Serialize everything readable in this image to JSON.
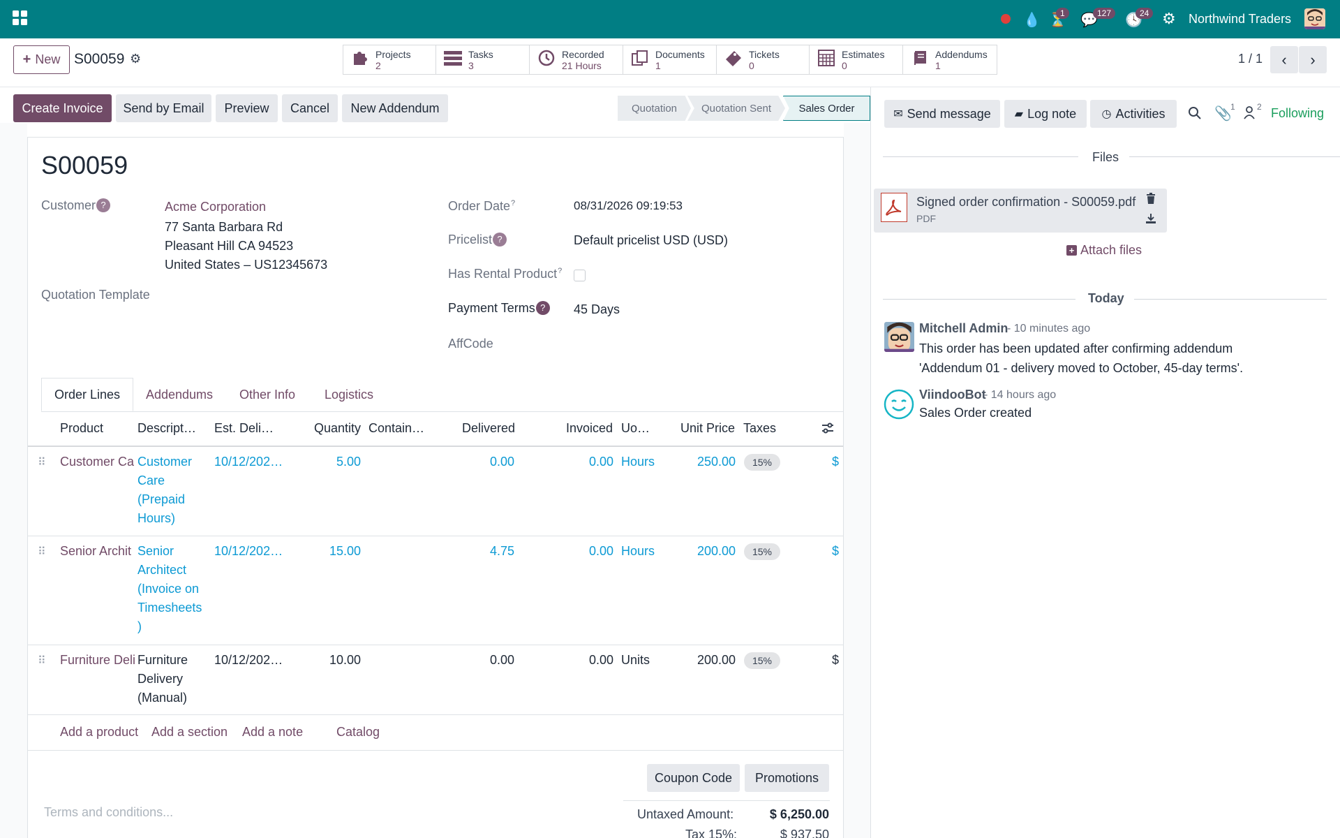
{
  "topbar": {
    "company": "Northwind Traders",
    "badges": {
      "activity": "1",
      "messages": "127",
      "clock": "24"
    }
  },
  "control": {
    "new_label": "New",
    "record_name": "S00059",
    "pager": "1 / 1"
  },
  "smart_buttons": [
    {
      "label": "Projects",
      "value": "2"
    },
    {
      "label": "Tasks",
      "value": "3"
    },
    {
      "label": "Recorded",
      "value": "21 Hours"
    },
    {
      "label": "Documents",
      "value": "1"
    },
    {
      "label": "Tickets",
      "value": "0"
    },
    {
      "label": "Estimates",
      "value": "0"
    },
    {
      "label": "Addendums",
      "value": "1"
    }
  ],
  "actions": {
    "create_invoice": "Create Invoice",
    "send_email": "Send by Email",
    "preview": "Preview",
    "cancel": "Cancel",
    "new_addendum": "New Addendum"
  },
  "stages": {
    "quotation": "Quotation",
    "sent": "Quotation Sent",
    "sales_order": "Sales Order"
  },
  "form": {
    "title": "S00059",
    "customer_label": "Customer",
    "customer_name": "Acme Corporation",
    "address1": "77 Santa Barbara Rd",
    "address2": "Pleasant Hill CA 94523",
    "address3": "United States – US12345673",
    "quotation_template_label": "Quotation Template",
    "order_date_label": "Order Date",
    "order_date": "08/31/2026 09:19:53",
    "pricelist_label": "Pricelist",
    "pricelist": "Default pricelist USD (USD)",
    "rental_label": "Has Rental Product",
    "payment_terms_label": "Payment Terms",
    "payment_terms": "45 Days",
    "affcode_label": "AffCode"
  },
  "tabs": [
    "Order Lines",
    "Addendums",
    "Other Info",
    "Logistics"
  ],
  "table": {
    "headers": {
      "product": "Product",
      "description": "Descript…",
      "delivery": "Est. Deli…",
      "quantity": "Quantity",
      "container": "Contain…",
      "delivered": "Delivered",
      "invoiced": "Invoiced",
      "uom": "Uo…",
      "unit_price": "Unit Price",
      "taxes": "Taxes"
    },
    "rows": [
      {
        "product": "Customer Ca",
        "description": "Customer Care (Prepaid Hours)",
        "delivery": "10/12/202…",
        "quantity": "5.00",
        "delivered": "0.00",
        "invoiced": "0.00",
        "uom": "Hours",
        "unit_price": "250.00",
        "tax": "15%",
        "subtotal": "$"
      },
      {
        "product": "Senior Archit",
        "description": "Senior Architect (Invoice on Timesheets )",
        "delivery": "10/12/202…",
        "quantity": "15.00",
        "delivered": "4.75",
        "invoiced": "0.00",
        "uom": "Hours",
        "unit_price": "200.00",
        "tax": "15%",
        "subtotal": "$"
      },
      {
        "product": "Furniture Deli",
        "description": "Furniture Delivery (Manual)",
        "delivery": "10/12/202…",
        "quantity": "10.00",
        "delivered": "0.00",
        "invoiced": "0.00",
        "uom": "Units",
        "unit_price": "200.00",
        "tax": "15%",
        "subtotal": "$"
      }
    ],
    "add_product": "Add a product",
    "add_section": "Add a section",
    "add_note": "Add a note",
    "catalog": "Catalog"
  },
  "footer": {
    "coupon": "Coupon Code",
    "promotions": "Promotions",
    "terms_placeholder": "Terms and conditions...",
    "untaxed_label": "Untaxed Amount:",
    "untaxed_value": "$ 6,250.00",
    "tax_label": "Tax 15%:",
    "tax_value": "$ 937.50"
  },
  "chatter": {
    "send_message": "Send message",
    "log_note": "Log note",
    "activities": "Activities",
    "attach_count": "1",
    "follower_count": "2",
    "following": "Following",
    "files_title": "Files",
    "file_name": "Signed order confirmation - S00059.pdf",
    "file_type": "PDF",
    "attach_files": "Attach files",
    "today": "Today",
    "messages": [
      {
        "author": "Mitchell Admin",
        "time": "- 10 minutes ago",
        "body": "This order has been updated after confirming addendum 'Addendum 01 - delivery moved to October, 45-day terms'."
      },
      {
        "author": "ViindooBot",
        "time": "- 14 hours ago",
        "body": "Sales Order created"
      }
    ]
  },
  "colors": {
    "topbar": "#017e84",
    "primary": "#714b67",
    "link_blue": "#0d9ad4",
    "following": "#1a9e5c"
  }
}
